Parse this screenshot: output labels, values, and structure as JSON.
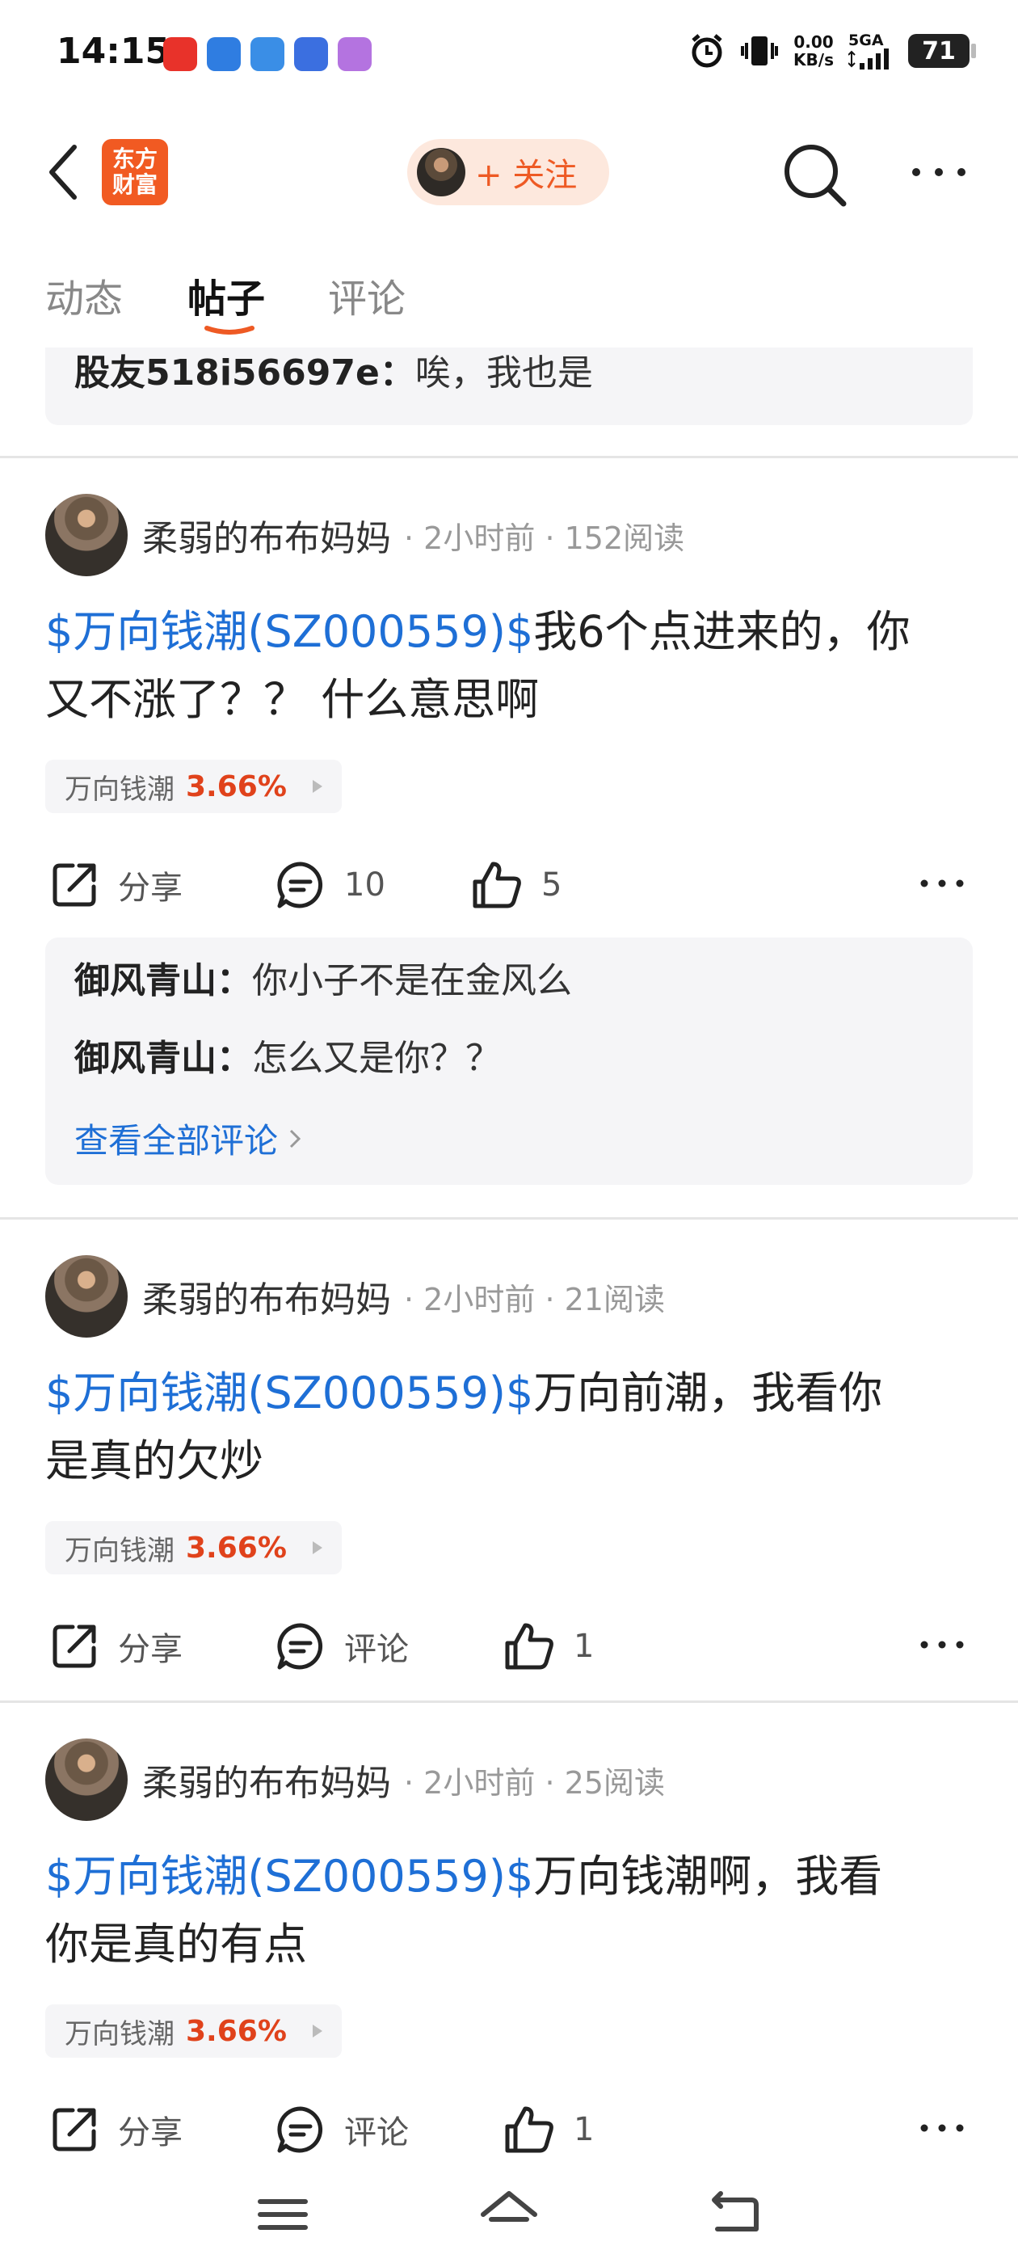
{
  "status_bar": {
    "time": "14:15",
    "net_speed_value": "0.00",
    "net_speed_unit": "KB/s",
    "signal_label": "5GA",
    "battery": "71",
    "app_icon_colors": [
      "#e8322a",
      "#2f7de1",
      "#3a8ee6",
      "#3b6fe0",
      "#b473e0"
    ]
  },
  "nav": {
    "logo_line1": "东方",
    "logo_line2": "财富",
    "follow_label": "+ 关注"
  },
  "tabs": [
    {
      "label": "动态"
    },
    {
      "label": "帖子"
    },
    {
      "label": "评论"
    }
  ],
  "prev_comment": {
    "user": "股友518i56697e：",
    "text": "唉，我也是"
  },
  "posts": [
    {
      "author": "柔弱的布布妈妈",
      "time": "2小时前",
      "reads": "152阅读",
      "stock_tag": "$万向钱潮(SZ000559)$",
      "text_line1": "我6个点进来的，你",
      "text_line2": "又不涨了？？ 什么意思啊",
      "chip_name": "万向钱潮",
      "chip_pct": "3.66%",
      "share_label": "分享",
      "comment_label": "10",
      "like_label": "5",
      "comments": [
        {
          "user": "御风青山：",
          "text": "你小子不是在金风么"
        },
        {
          "user": "御风青山：",
          "text": "怎么又是你？？"
        }
      ],
      "view_all": "查看全部评论"
    },
    {
      "author": "柔弱的布布妈妈",
      "time": "2小时前",
      "reads": "21阅读",
      "stock_tag": "$万向钱潮(SZ000559)$",
      "text_line1": "万向前潮，我看你",
      "text_line2": "是真的欠炒",
      "chip_name": "万向钱潮",
      "chip_pct": "3.66%",
      "share_label": "分享",
      "comment_label": "评论",
      "like_label": "1"
    },
    {
      "author": "柔弱的布布妈妈",
      "time": "2小时前",
      "reads": "25阅读",
      "stock_tag": "$万向钱潮(SZ000559)$",
      "text_line1": "万向钱潮啊，我看",
      "text_line2": "你是真的有点",
      "chip_name": "万向钱潮",
      "chip_pct": "3.66%",
      "share_label": "分享",
      "comment_label": "评论",
      "like_label": "1"
    }
  ],
  "colors": {
    "accent_orange": "#ee5a24",
    "link_blue": "#1e6fd6",
    "rise_red": "#e0421b"
  }
}
